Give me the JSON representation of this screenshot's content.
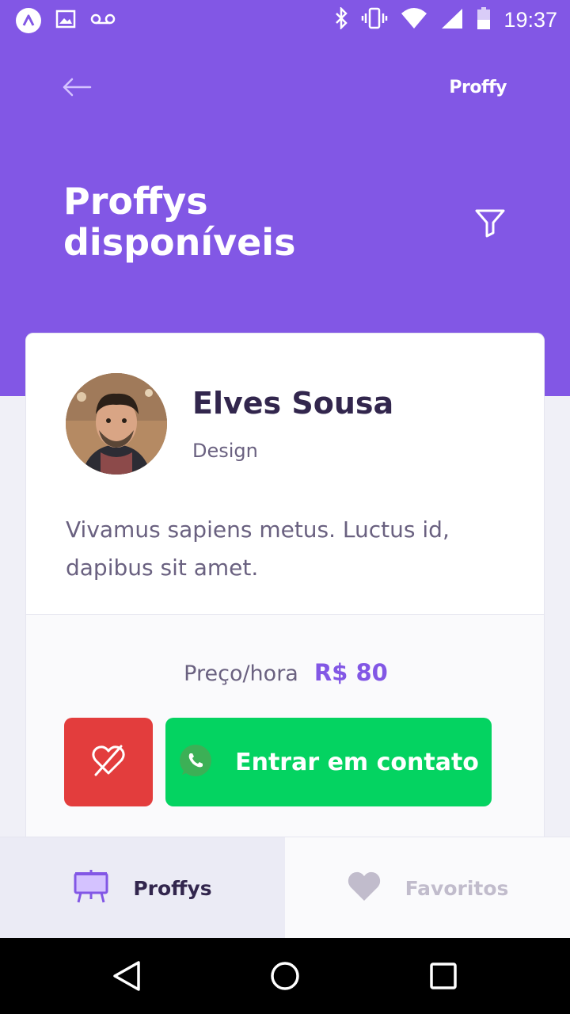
{
  "status_bar": {
    "time": "19:37",
    "left_icons": [
      "app-logo-icon",
      "image-icon",
      "voicemail-icon"
    ],
    "right_icons": [
      "bluetooth-icon",
      "vibrate-icon",
      "wifi-icon",
      "signal-icon",
      "battery-icon"
    ]
  },
  "header": {
    "back_icon": "arrow-left-icon",
    "brand": "Proffy",
    "title": "Proffys disponíveis",
    "filter_icon": "filter-icon"
  },
  "teacher_card": {
    "name": "Elves Sousa",
    "subject": "Design",
    "bio": "Vivamus sapiens metus. Luctus id, dapibus sit amet.",
    "price_label": "Preço/hora",
    "price_value": "R$ 80",
    "unfavorite_icon": "heart-outline-crossed-icon",
    "contact_label": "Entrar em contato",
    "contact_icon": "whatsapp-icon"
  },
  "tabs": [
    {
      "label": "Proffys",
      "icon": "easel-icon",
      "active": true
    },
    {
      "label": "Favoritos",
      "icon": "heart-icon",
      "active": false
    }
  ],
  "nav_bar": {
    "icons": [
      "back-triangle-icon",
      "home-circle-icon",
      "recents-square-icon"
    ]
  },
  "colors": {
    "primary": "#8257e5",
    "danger": "#e33d3d",
    "success": "#04d361",
    "title_text": "#32264d",
    "body_text": "#6a6180"
  }
}
